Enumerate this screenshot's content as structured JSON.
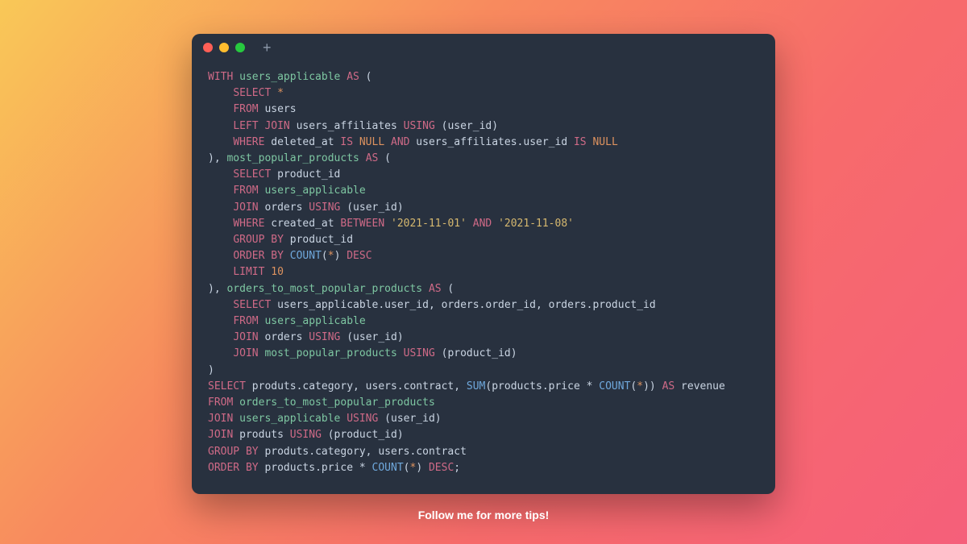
{
  "window": {
    "traffic": [
      "close",
      "minimize",
      "zoom"
    ],
    "new_tab_glyph": "+"
  },
  "code": {
    "tokens": [
      [
        [
          "kw",
          "WITH"
        ],
        [
          "pn",
          " "
        ],
        [
          "id",
          "users_applicable"
        ],
        [
          "pn",
          " "
        ],
        [
          "kw",
          "AS"
        ],
        [
          "pn",
          " ("
        ]
      ],
      [
        [
          "pn",
          "    "
        ],
        [
          "kw",
          "SELECT"
        ],
        [
          "pn",
          " "
        ],
        [
          "star",
          "*"
        ]
      ],
      [
        [
          "pn",
          "    "
        ],
        [
          "kw",
          "FROM"
        ],
        [
          "pn",
          " users"
        ]
      ],
      [
        [
          "pn",
          "    "
        ],
        [
          "kw",
          "LEFT"
        ],
        [
          "pn",
          " "
        ],
        [
          "kw",
          "JOIN"
        ],
        [
          "pn",
          " users_affiliates "
        ],
        [
          "kw",
          "USING"
        ],
        [
          "pn",
          " (user_id)"
        ]
      ],
      [
        [
          "pn",
          "    "
        ],
        [
          "kw",
          "WHERE"
        ],
        [
          "pn",
          " deleted_at "
        ],
        [
          "kw",
          "IS"
        ],
        [
          "pn",
          " "
        ],
        [
          "nullkw",
          "NULL"
        ],
        [
          "pn",
          " "
        ],
        [
          "kw",
          "AND"
        ],
        [
          "pn",
          " users_affiliates.user_id "
        ],
        [
          "kw",
          "IS"
        ],
        [
          "pn",
          " "
        ],
        [
          "nullkw",
          "NULL"
        ]
      ],
      [
        [
          "pn",
          "), "
        ],
        [
          "id",
          "most_popular_products"
        ],
        [
          "pn",
          " "
        ],
        [
          "kw",
          "AS"
        ],
        [
          "pn",
          " ("
        ]
      ],
      [
        [
          "pn",
          "    "
        ],
        [
          "kw",
          "SELECT"
        ],
        [
          "pn",
          " product_id"
        ]
      ],
      [
        [
          "pn",
          "    "
        ],
        [
          "kw",
          "FROM"
        ],
        [
          "pn",
          " "
        ],
        [
          "id",
          "users_applicable"
        ]
      ],
      [
        [
          "pn",
          "    "
        ],
        [
          "kw",
          "JOIN"
        ],
        [
          "pn",
          " orders "
        ],
        [
          "kw",
          "USING"
        ],
        [
          "pn",
          " (user_id)"
        ]
      ],
      [
        [
          "pn",
          "    "
        ],
        [
          "kw",
          "WHERE"
        ],
        [
          "pn",
          " created_at "
        ],
        [
          "kw",
          "BETWEEN"
        ],
        [
          "pn",
          " "
        ],
        [
          "str",
          "'2021-11-01'"
        ],
        [
          "pn",
          " "
        ],
        [
          "kw",
          "AND"
        ],
        [
          "pn",
          " "
        ],
        [
          "str",
          "'2021-11-08'"
        ]
      ],
      [
        [
          "pn",
          "    "
        ],
        [
          "kw",
          "GROUP"
        ],
        [
          "pn",
          " "
        ],
        [
          "kw",
          "BY"
        ],
        [
          "pn",
          " product_id"
        ]
      ],
      [
        [
          "pn",
          "    "
        ],
        [
          "kw",
          "ORDER"
        ],
        [
          "pn",
          " "
        ],
        [
          "kw",
          "BY"
        ],
        [
          "pn",
          " "
        ],
        [
          "fn",
          "COUNT"
        ],
        [
          "pn",
          "("
        ],
        [
          "star",
          "*"
        ],
        [
          "pn",
          ") "
        ],
        [
          "kw",
          "DESC"
        ]
      ],
      [
        [
          "pn",
          "    "
        ],
        [
          "kw",
          "LIMIT"
        ],
        [
          "pn",
          " "
        ],
        [
          "num",
          "10"
        ]
      ],
      [
        [
          "pn",
          "), "
        ],
        [
          "id",
          "orders_to_most_popular_products"
        ],
        [
          "pn",
          " "
        ],
        [
          "kw",
          "AS"
        ],
        [
          "pn",
          " ("
        ]
      ],
      [
        [
          "pn",
          "    "
        ],
        [
          "kw",
          "SELECT"
        ],
        [
          "pn",
          " users_applicable.user_id, orders.order_id, orders.product_id"
        ]
      ],
      [
        [
          "pn",
          "    "
        ],
        [
          "kw",
          "FROM"
        ],
        [
          "pn",
          " "
        ],
        [
          "id",
          "users_applicable"
        ]
      ],
      [
        [
          "pn",
          "    "
        ],
        [
          "kw",
          "JOIN"
        ],
        [
          "pn",
          " orders "
        ],
        [
          "kw",
          "USING"
        ],
        [
          "pn",
          " (user_id)"
        ]
      ],
      [
        [
          "pn",
          "    "
        ],
        [
          "kw",
          "JOIN"
        ],
        [
          "pn",
          " "
        ],
        [
          "id",
          "most_popular_products"
        ],
        [
          "pn",
          " "
        ],
        [
          "kw",
          "USING"
        ],
        [
          "pn",
          " (product_id)"
        ]
      ],
      [
        [
          "pn",
          ")"
        ]
      ],
      [
        [
          "kw",
          "SELECT"
        ],
        [
          "pn",
          " produts.category, users.contract, "
        ],
        [
          "fn",
          "SUM"
        ],
        [
          "pn",
          "(products.price "
        ],
        [
          "op",
          "*"
        ],
        [
          "pn",
          " "
        ],
        [
          "fn",
          "COUNT"
        ],
        [
          "pn",
          "("
        ],
        [
          "star",
          "*"
        ],
        [
          "pn",
          ")) "
        ],
        [
          "kw",
          "AS"
        ],
        [
          "pn",
          " revenue"
        ]
      ],
      [
        [
          "kw",
          "FROM"
        ],
        [
          "pn",
          " "
        ],
        [
          "id",
          "orders_to_most_popular_products"
        ]
      ],
      [
        [
          "kw",
          "JOIN"
        ],
        [
          "pn",
          " "
        ],
        [
          "id",
          "users_applicable"
        ],
        [
          "pn",
          " "
        ],
        [
          "kw",
          "USING"
        ],
        [
          "pn",
          " (user_id)"
        ]
      ],
      [
        [
          "kw",
          "JOIN"
        ],
        [
          "pn",
          " produts "
        ],
        [
          "kw",
          "USING"
        ],
        [
          "pn",
          " (product_id)"
        ]
      ],
      [
        [
          "kw",
          "GROUP"
        ],
        [
          "pn",
          " "
        ],
        [
          "kw",
          "BY"
        ],
        [
          "pn",
          " produts.category, users.contract"
        ]
      ],
      [
        [
          "kw",
          "ORDER"
        ],
        [
          "pn",
          " "
        ],
        [
          "kw",
          "BY"
        ],
        [
          "pn",
          " products.price "
        ],
        [
          "op",
          "*"
        ],
        [
          "pn",
          " "
        ],
        [
          "fn",
          "COUNT"
        ],
        [
          "pn",
          "("
        ],
        [
          "star",
          "*"
        ],
        [
          "pn",
          ") "
        ],
        [
          "kw",
          "DESC"
        ],
        [
          "pn",
          ";"
        ]
      ]
    ]
  },
  "footer": {
    "text": "Follow me for more tips!"
  }
}
